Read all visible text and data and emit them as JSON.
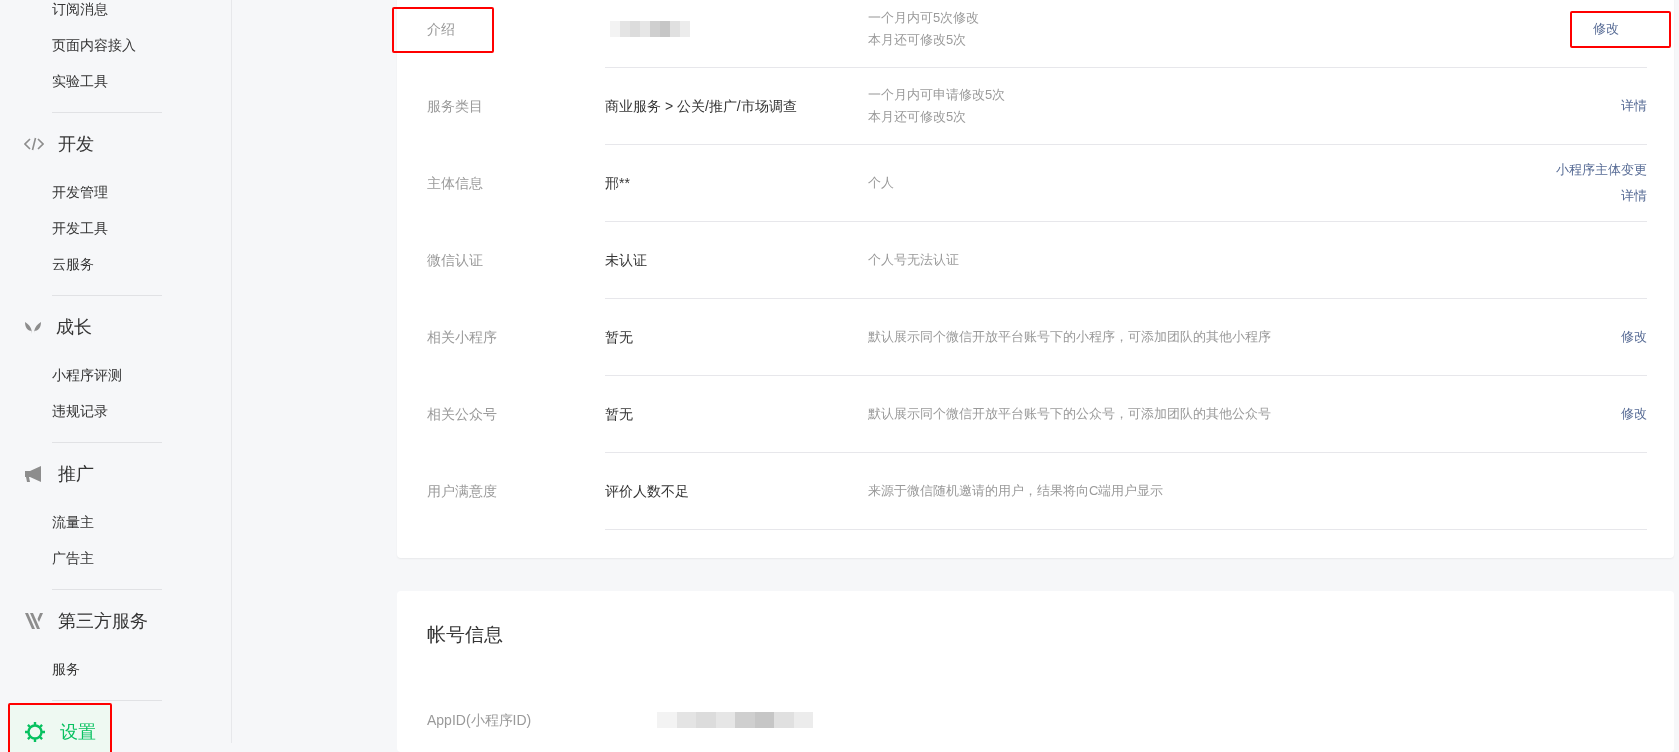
{
  "sidebar": {
    "sections": [
      {
        "items": [
          "订阅消息",
          "页面内容接入",
          "实验工具"
        ]
      },
      {
        "kind": "code",
        "title": "开发",
        "selected": false,
        "items": [
          "开发管理",
          "开发工具",
          "云服务"
        ]
      },
      {
        "kind": "sprout",
        "title": "成长",
        "selected": false,
        "items": [
          "小程序评测",
          "违规记录"
        ]
      },
      {
        "kind": "megaphone",
        "title": "推广",
        "selected": false,
        "items": [
          "流量主",
          "广告主"
        ]
      },
      {
        "kind": "thirdparty",
        "title": "第三方服务",
        "selected": false,
        "items": [
          "服务"
        ]
      },
      {
        "kind": "gear",
        "title": "设置",
        "selected": true,
        "highlighted": true
      }
    ]
  },
  "info_card": {
    "rows": [
      {
        "label": "介绍",
        "label_highlighted": true,
        "notes": [
          "一个月内可5次修改",
          "本月还可修改5次"
        ],
        "actions": [
          {
            "text": "修改",
            "highlighted": true
          }
        ]
      },
      {
        "label": "服务类目",
        "label_highlighted": false,
        "value": "商业服务 > 公关/推广/市场调查",
        "notes": [
          "一个月内可申请修改5次",
          "本月还可修改5次"
        ],
        "actions": [
          {
            "text": "详情",
            "highlighted": false
          }
        ]
      },
      {
        "label": "主体信息",
        "label_highlighted": false,
        "value": "邢**",
        "notes": [
          "个人"
        ],
        "actions": [
          {
            "text": "小程序主体变更",
            "highlighted": false
          },
          {
            "text": "详情",
            "highlighted": false
          }
        ]
      },
      {
        "label": "微信认证",
        "label_highlighted": false,
        "value": "未认证",
        "notes": [
          "个人号无法认证"
        ],
        "actions": []
      },
      {
        "label": "相关小程序",
        "label_highlighted": false,
        "value": "暂无",
        "notes": [
          "默认展示同个微信开放平台账号下的小程序，可添加团队的其他小程序"
        ],
        "actions": [
          {
            "text": "修改",
            "highlighted": false
          }
        ]
      },
      {
        "label": "相关公众号",
        "label_highlighted": false,
        "value": "暂无",
        "notes": [
          "默认展示同个微信开放平台账号下的公众号，可添加团队的其他公众号"
        ],
        "actions": [
          {
            "text": "修改",
            "highlighted": false
          }
        ]
      },
      {
        "label": "用户满意度",
        "label_highlighted": false,
        "value": "评价人数不足",
        "notes": [
          "来源于微信随机邀请的用户，结果将向C端用户显示"
        ],
        "actions": []
      }
    ]
  },
  "account_card": {
    "title": "帐号信息",
    "rows": [
      {
        "label": "AppID(小程序ID)"
      }
    ]
  }
}
